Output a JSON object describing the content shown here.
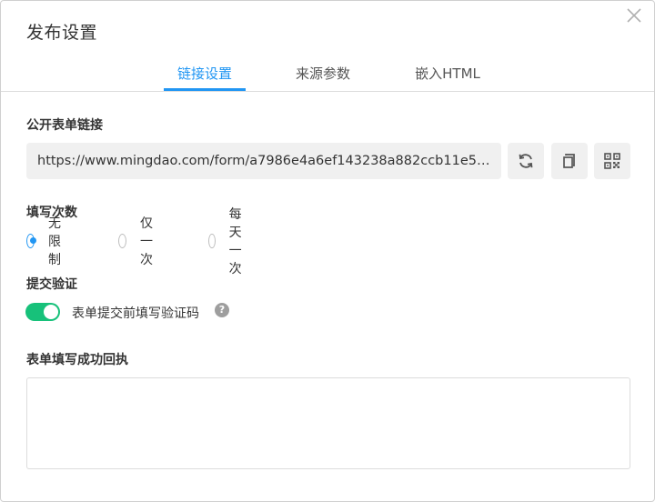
{
  "dialog": {
    "title": "发布设置"
  },
  "tabs": [
    {
      "label": "链接设置",
      "active": true
    },
    {
      "label": "来源参数",
      "active": false
    },
    {
      "label": "嵌入HTML",
      "active": false
    }
  ],
  "link_section": {
    "label": "公开表单链接",
    "url": "https://www.mingdao.com/form/a7986e4a6ef143238a882ccb11e52…",
    "buttons": {
      "refresh": "refresh-icon",
      "copy": "copy-icon",
      "qr": "qr-code-icon"
    }
  },
  "fill_count": {
    "label": "填写次数",
    "options": [
      {
        "label": "无限制",
        "checked": true
      },
      {
        "label": "仅一次",
        "checked": false
      },
      {
        "label": "每天一次",
        "checked": false
      }
    ]
  },
  "verification": {
    "label": "提交验证",
    "toggle_on": true,
    "toggle_label": "表单提交前填写验证码",
    "help_glyph": "?"
  },
  "receipt": {
    "label": "表单填写成功回执",
    "value": ""
  },
  "colors": {
    "accent": "#2196f3",
    "toggle": "#17c17a",
    "field_bg": "#f0f0f0"
  }
}
